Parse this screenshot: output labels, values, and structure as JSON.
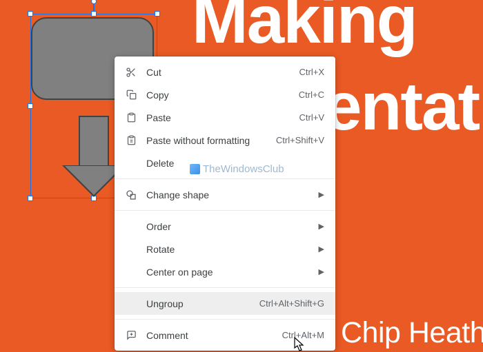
{
  "background": {
    "text1": "Making",
    "text2": "entati",
    "text3": "Chip Heath"
  },
  "menu": {
    "cut": {
      "label": "Cut",
      "shortcut": "Ctrl+X"
    },
    "copy": {
      "label": "Copy",
      "shortcut": "Ctrl+C"
    },
    "paste": {
      "label": "Paste",
      "shortcut": "Ctrl+V"
    },
    "paste_no_fmt": {
      "label": "Paste without formatting",
      "shortcut": "Ctrl+Shift+V"
    },
    "delete": {
      "label": "Delete"
    },
    "change_shape": {
      "label": "Change shape"
    },
    "order": {
      "label": "Order"
    },
    "rotate": {
      "label": "Rotate"
    },
    "center": {
      "label": "Center on page"
    },
    "ungroup": {
      "label": "Ungroup",
      "shortcut": "Ctrl+Alt+Shift+G"
    },
    "comment": {
      "label": "Comment",
      "shortcut": "Ctrl+Alt+M"
    }
  },
  "watermark": "TheWindowsClub"
}
